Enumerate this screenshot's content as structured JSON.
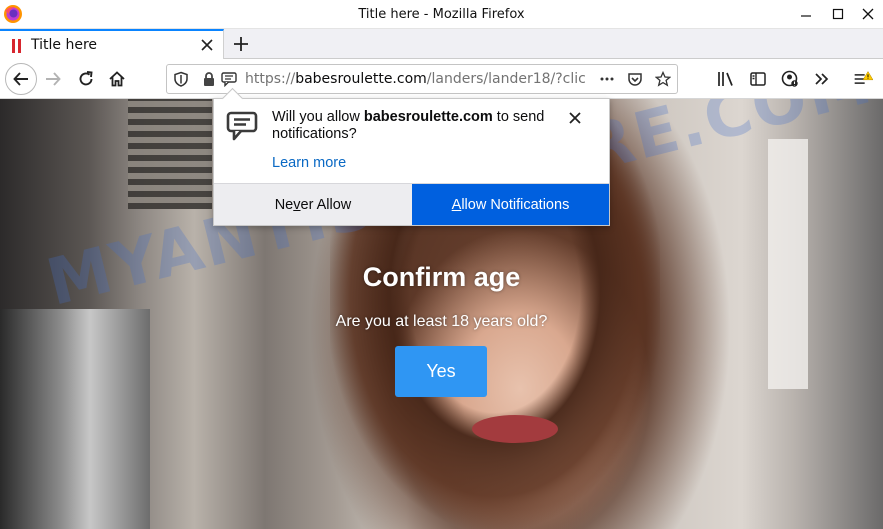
{
  "window": {
    "title": "Title here - Mozilla Firefox"
  },
  "tab": {
    "label": "Title here"
  },
  "address_bar": {
    "url_prefix": "https://",
    "url_host": "babesroulette.com",
    "url_path": "/landers/lander18/?clic"
  },
  "notification": {
    "message_prefix": "Will you allow ",
    "message_host": "babesroulette.com",
    "message_suffix": " to send notifications?",
    "learn_more": "Learn more",
    "never_allow": {
      "before": "Ne",
      "mnemonic": "v",
      "after": "er Allow"
    },
    "allow": {
      "mnemonic": "A",
      "after": "llow Notifications"
    },
    "accent_color": "#0060df"
  },
  "page": {
    "title": "Confirm age",
    "question": "Are you at least 18 years old?",
    "yes_label": "Yes",
    "button_color": "#2f96f3",
    "watermark": "MYANTISPYWARE.COM"
  },
  "icons": [
    "firefox-logo",
    "minimize-icon",
    "maximize-icon",
    "close-icon",
    "tab-favicon",
    "tab-close-icon",
    "new-tab-icon",
    "back-icon",
    "forward-icon",
    "reload-icon",
    "home-icon",
    "shield-icon",
    "lock-icon",
    "notification-permission-icon",
    "page-actions-icon",
    "pocket-icon",
    "bookmark-star-icon",
    "library-icon",
    "sidebar-icon",
    "account-icon",
    "overflow-icon",
    "menu-icon",
    "speech-bubble-icon"
  ]
}
